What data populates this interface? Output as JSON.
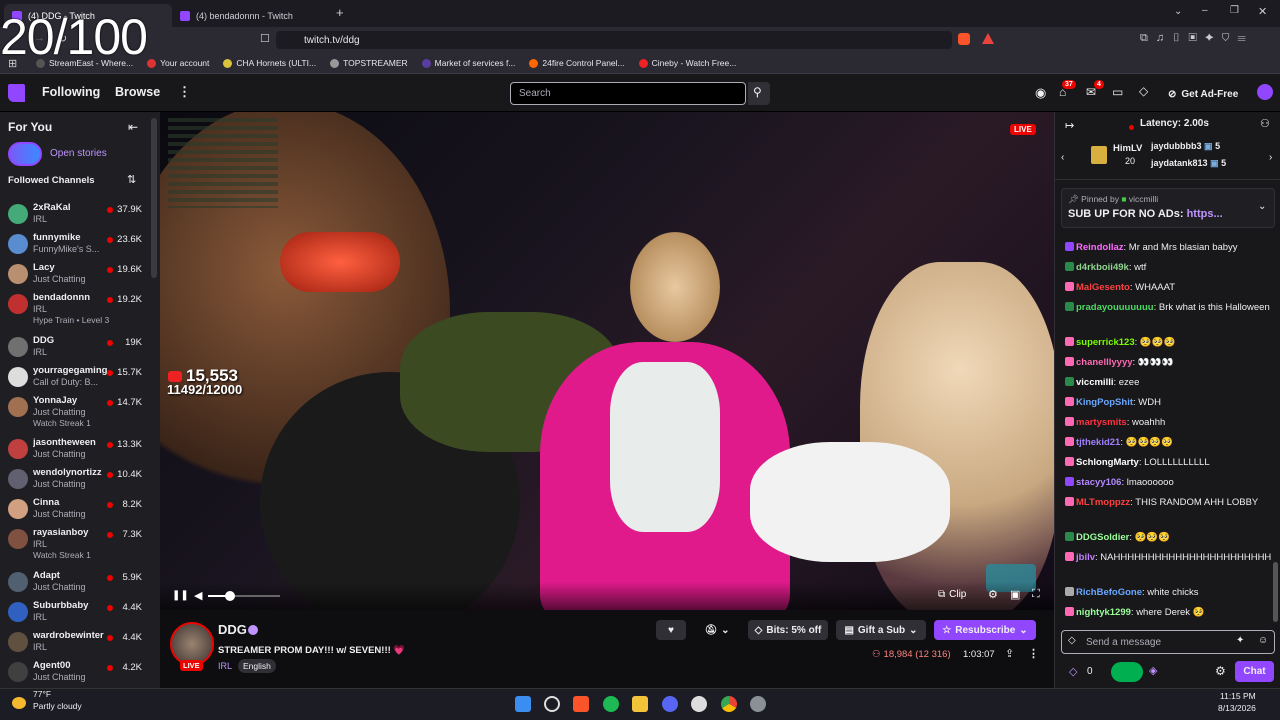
{
  "overlay_counter": "20/100",
  "browser": {
    "tabs": [
      {
        "title": "(4) DDG - Twitch"
      },
      {
        "title": "(4) bendadonnn - Twitch"
      }
    ],
    "url": "twitch.tv/ddg",
    "bookmarks": [
      "StreamEast - Where...",
      "Your account",
      "CHA Hornets (ULTI...",
      "TOPSTREAMER",
      "Market of services f...",
      "24fire Control Panel...",
      "Cineby - Watch Free..."
    ]
  },
  "topnav": {
    "following": "Following",
    "browse": "Browse",
    "search_placeholder": "Search",
    "notif_count": "37",
    "inbox_count": "4",
    "ad_free": "Get Ad-Free"
  },
  "sidebar": {
    "for_you": "For You",
    "open_stories": "Open stories",
    "followed": "Followed Channels",
    "channels": [
      {
        "name": "2xRaKaI",
        "cat": "IRL",
        "viewers": "37.9K",
        "color": "#4a7"
      },
      {
        "name": "funnymike",
        "cat": "FunnyMike's S...",
        "viewers": "23.6K",
        "color": "#5a8cd0"
      },
      {
        "name": "Lacy",
        "cat": "Just Chatting",
        "viewers": "19.6K",
        "color": "#b89070"
      },
      {
        "name": "bendadonnn",
        "cat": "IRL",
        "viewers": "19.2K",
        "color": "#c03030",
        "extra": "Hype Train • Level 3"
      },
      {
        "name": "DDG",
        "cat": "IRL",
        "viewers": "19K",
        "color": "#707070"
      },
      {
        "name": "yourragegaming",
        "cat": "Call of Duty: B...",
        "viewers": "15.7K",
        "color": "#ddd"
      },
      {
        "name": "YonnaJay",
        "cat": "Just Chatting",
        "viewers": "14.7K",
        "color": "#a07050",
        "extra": "Watch Streak 1"
      },
      {
        "name": "jasontheween",
        "cat": "Just Chatting",
        "viewers": "13.3K",
        "color": "#c04040"
      },
      {
        "name": "wendolynortizz",
        "cat": "Just Chatting",
        "viewers": "10.4K",
        "color": "#606070"
      },
      {
        "name": "Cinna",
        "cat": "Just Chatting",
        "viewers": "8.2K",
        "color": "#d0a080"
      },
      {
        "name": "rayasianboy",
        "cat": "IRL",
        "viewers": "7.3K",
        "color": "#805040",
        "extra": "Watch Streak 1"
      },
      {
        "name": "Adapt",
        "cat": "Just Chatting",
        "viewers": "5.9K",
        "color": "#506070"
      },
      {
        "name": "Suburbbaby",
        "cat": "IRL",
        "viewers": "4.4K",
        "color": "#3060c0"
      },
      {
        "name": "wardrobewinter",
        "cat": "IRL",
        "viewers": "4.4K",
        "color": "#605040"
      },
      {
        "name": "Agent00",
        "cat": "Just Chatting",
        "viewers": "4.2K",
        "color": "#404040"
      }
    ]
  },
  "player": {
    "live": "LIVE",
    "goal_count": "15,553",
    "goal_progress": "11492/12000",
    "clip": "Clip"
  },
  "stream": {
    "channel": "DDG",
    "title": "STREAMER PROM DAY!!! w/ SEVEN!!! 💗",
    "tags": [
      "IRL",
      "English"
    ],
    "live_badge": "LIVE",
    "bits": "Bits: 5% off",
    "gift": "Gift a Sub",
    "resub": "Resubscribe",
    "viewers": "18,984 (12 316)",
    "uptime": "1:03:07"
  },
  "chat": {
    "latency": "Latency: 2.00s",
    "gifter": "HimLV",
    "gifter_count": "20",
    "top": [
      {
        "name": "jaydubbbb3",
        "n": "5"
      },
      {
        "name": "jaydatank813",
        "n": "5"
      }
    ],
    "pinned_by": "Pinned by",
    "pinned_user": "viccmilli",
    "pinned_text": "SUB UP FOR NO ADs: ",
    "pinned_link": "https...",
    "messages": [
      {
        "user": "Reindollaz",
        "color": "#ff6aff",
        "text": ": Mr and Mrs blasian babyy"
      },
      {
        "user": "d4rkboii49k",
        "color": "#8fd48f",
        "text": ": wtf"
      },
      {
        "user": "MalGesento",
        "color": "#ff4040",
        "text": ": WHAAAT"
      },
      {
        "user": "pradayouuuuuuu",
        "color": "#4cd964",
        "text": ": Brk what is this Halloween"
      },
      {
        "user": "superrick123",
        "color": "#7cfc00",
        "text": ": 🥺🥺🥺"
      },
      {
        "user": "chanelllyyyy",
        "color": "#ff69b4",
        "text": ": 👀👀👀"
      },
      {
        "user": "viccmilli",
        "color": "#ffffff",
        "text": ": ezee"
      },
      {
        "user": "KingPopShit",
        "color": "#6aa8ff",
        "text": ": WDH"
      },
      {
        "user": "martysmits",
        "color": "#ff3040",
        "text": ": woahhh"
      },
      {
        "user": "tjthekid21",
        "color": "#a080ff",
        "text": ": 🥺🥺🥺🥺"
      },
      {
        "user": "SchlongMarty",
        "color": "#ffffff",
        "text": ": LOLLLLLLLLLL"
      },
      {
        "user": "stacyy106",
        "color": "#b388ff",
        "text": ": lmaoooooo"
      },
      {
        "user": "MLTmoppzz",
        "color": "#ff4040",
        "text": ": THIS RANDOM AHH LOBBY"
      },
      {
        "user": "DDGSoldier",
        "color": "#9aff9a",
        "text": ": 🥺🥺🥺"
      },
      {
        "user": "jbilv",
        "color": "#c080ff",
        "text": ": NAHHHHHHHHHHHHHHHHHHHHHHH"
      },
      {
        "user": "RichBefoGone",
        "color": "#6aa8ff",
        "text": ": white chicks"
      },
      {
        "user": "nightyk1299",
        "color": "#9aff9a",
        "text": ": where Derek 🥺"
      }
    ],
    "input_placeholder": "Send a message",
    "points": "0",
    "chat_btn": "Chat"
  },
  "taskbar": {
    "temp": "77°F",
    "weather": "Partly cloudy",
    "time": "11:15 PM",
    "date": "8/13/2026"
  }
}
